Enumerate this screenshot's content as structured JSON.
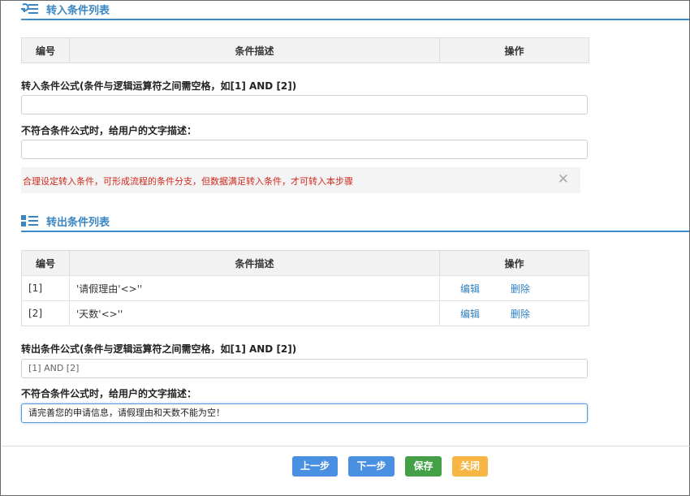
{
  "in_section": {
    "title": "转入条件列表",
    "icon": "list-settings-icon",
    "columns": [
      "编号",
      "条件描述",
      "操作"
    ],
    "formula_label": "转入条件公式(条件与逻辑运算符之间需空格，如[1] AND [2])",
    "formula_value": "",
    "desc_label": "不符合条件公式时，给用户的文字描述：",
    "desc_value": "",
    "alert_text": "合理设定转入条件，可形成流程的条件分支，但数据满足转入条件，才可转入本步骤",
    "alert_close": "✕"
  },
  "out_section": {
    "title": "转出条件列表",
    "icon": "list-icon",
    "columns": [
      "编号",
      "条件描述",
      "操作"
    ],
    "rows": [
      {
        "id": "[1]",
        "desc": "'请假理由'<>''",
        "edit": "编辑",
        "delete": "删除"
      },
      {
        "id": "[2]",
        "desc": "'天数'<>''",
        "edit": "编辑",
        "delete": "删除"
      }
    ],
    "formula_label": "转出条件公式(条件与逻辑运算符之间需空格，如[1] AND [2])",
    "formula_value": "[1] AND [2]",
    "desc_label": "不符合条件公式时，给用户的文字描述：",
    "desc_value": "请完善您的申请信息，请假理由和天数不能为空！"
  },
  "buttons": {
    "prev": "上一步",
    "next": "下一步",
    "save": "保存",
    "close": "关闭"
  },
  "colors": {
    "accent": "#3a86c3",
    "alert_text": "#d0281b",
    "btn_blue": "#4a90e2",
    "btn_green": "#43a047",
    "btn_orange": "#f7b544"
  }
}
